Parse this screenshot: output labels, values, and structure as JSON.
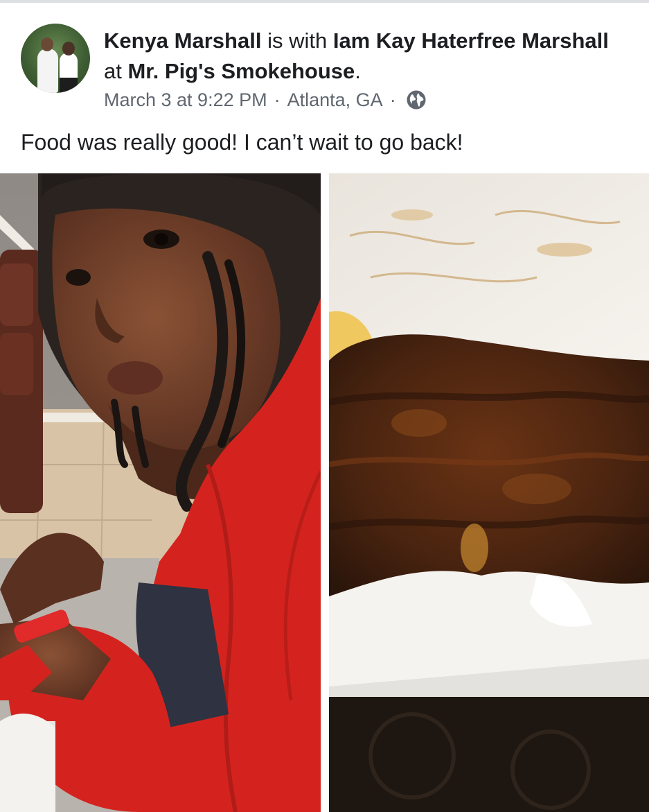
{
  "post": {
    "author": "Kenya Marshall",
    "connector_with": "is with",
    "tagged_name": "Iam Kay Haterfree Marshall",
    "connector_at": "at",
    "place": "Mr. Pig's Smokehouse",
    "end_punct": ".",
    "date": "March 3 at 9:22 PM",
    "location": "Atlanta, GA",
    "separator": "·",
    "privacy_icon": "globe-icon",
    "caption": "Food was really good! I can’t wait to go back!"
  },
  "photos": [
    {
      "subject": "selfie",
      "icon": "photo"
    },
    {
      "subject": "ribs",
      "icon": "photo"
    }
  ],
  "colors": {
    "text_primary": "#1c1e21",
    "text_secondary": "#606770",
    "shirt_red": "#d4231e",
    "sauce_brown": "#4a2410"
  }
}
